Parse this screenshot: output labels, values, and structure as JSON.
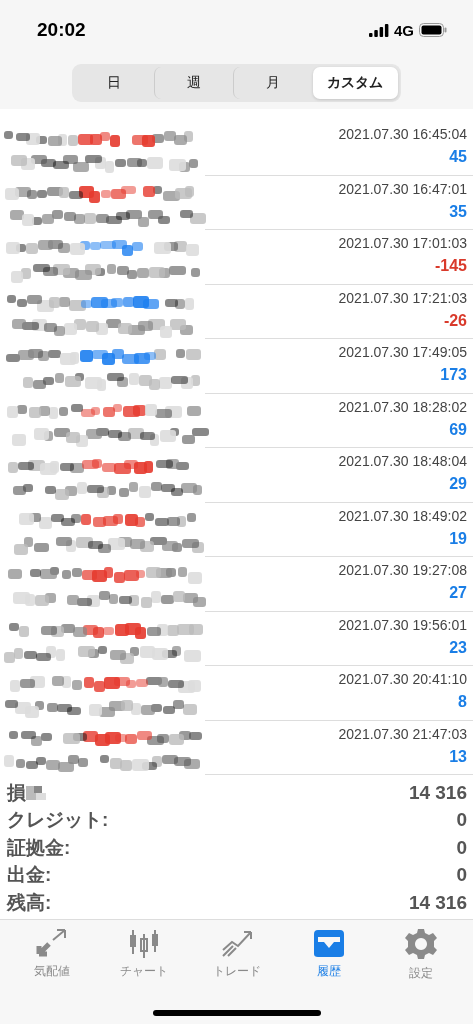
{
  "status_bar": {
    "time": "20:02",
    "network": "4G"
  },
  "segments": [
    {
      "label": "日",
      "selected": false
    },
    {
      "label": "週",
      "selected": false
    },
    {
      "label": "月",
      "selected": false
    },
    {
      "label": "カスタム",
      "selected": true
    }
  ],
  "deals": [
    {
      "kind": "sell",
      "time": "2021.07.30 16:45:04",
      "profit": "45",
      "loss": false
    },
    {
      "kind": "sell",
      "time": "2021.07.30 16:47:01",
      "profit": "35",
      "loss": false
    },
    {
      "kind": "buy",
      "time": "2021.07.30 17:01:03",
      "profit": "-145",
      "loss": true
    },
    {
      "kind": "buy",
      "time": "2021.07.30 17:21:03",
      "profit": "-26",
      "loss": true
    },
    {
      "kind": "buy",
      "time": "2021.07.30 17:49:05",
      "profit": "173",
      "loss": false
    },
    {
      "kind": "sell",
      "time": "2021.07.30 18:28:02",
      "profit": "69",
      "loss": false
    },
    {
      "kind": "sell",
      "time": "2021.07.30 18:48:04",
      "profit": "29",
      "loss": false
    },
    {
      "kind": "sell",
      "time": "2021.07.30 18:49:02",
      "profit": "19",
      "loss": false
    },
    {
      "kind": "sell",
      "time": "2021.07.30 19:27:08",
      "profit": "27",
      "loss": false
    },
    {
      "kind": "sell",
      "time": "2021.07.30 19:56:01",
      "profit": "23",
      "loss": false
    },
    {
      "kind": "sell",
      "time": "2021.07.30 20:41:10",
      "profit": "8",
      "loss": false
    },
    {
      "kind": "sell",
      "time": "2021.07.30 21:47:03",
      "profit": "13",
      "loss": false
    }
  ],
  "summary": [
    {
      "label": "損",
      "value": "14 316",
      "kind": "masked"
    },
    {
      "label": "クレジット:",
      "value": "0",
      "kind": "plain"
    },
    {
      "label": "証拠金:",
      "value": "0",
      "kind": "plain"
    },
    {
      "label": "出金:",
      "value": "0",
      "kind": "plain"
    },
    {
      "label": "残高:",
      "value": "14 316",
      "kind": "plain"
    }
  ],
  "tab_bar": [
    {
      "label": "気配値",
      "kind": "quotes",
      "selected": false
    },
    {
      "label": "チャート",
      "kind": "chart",
      "selected": false
    },
    {
      "label": "トレード",
      "kind": "trade",
      "selected": false
    },
    {
      "label": "履歴",
      "kind": "history",
      "selected": true
    },
    {
      "label": "設定",
      "kind": "settings",
      "selected": false
    }
  ]
}
